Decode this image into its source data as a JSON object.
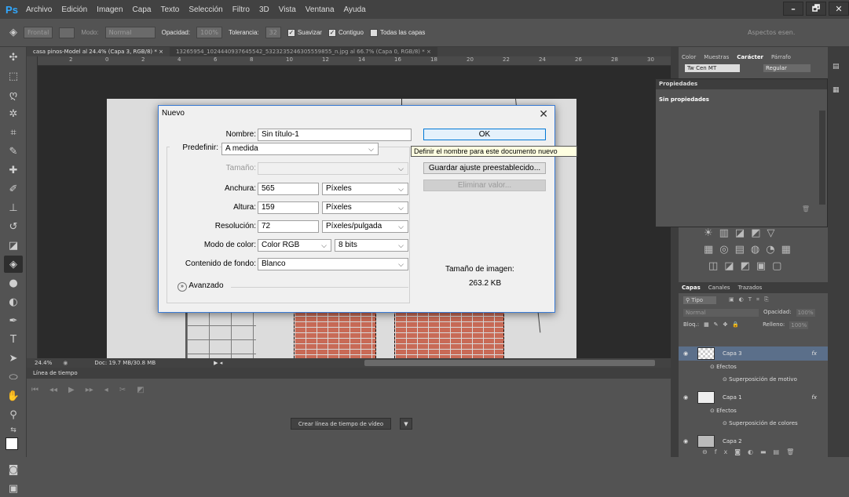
{
  "app": {
    "logo": "Ps"
  },
  "menu": [
    "Archivo",
    "Edición",
    "Imagen",
    "Capa",
    "Texto",
    "Selección",
    "Filtro",
    "3D",
    "Vista",
    "Ventana",
    "Ayuda"
  ],
  "window_controls": {
    "minimize": "–",
    "restore": "🗗",
    "close": "✕"
  },
  "options": {
    "frontal": "Frontal",
    "modo_label": "Modo:",
    "modo_value": "Normal",
    "opacidad_label": "Opacidad:",
    "opacidad_value": "100%",
    "tolerancia_label": "Tolerancia:",
    "tolerancia_value": "32",
    "suavizar": "Suavizar",
    "contiguo": "Contiguo",
    "todas_capas": "Todas las capas",
    "workspace": "Aspectos esen."
  },
  "tabs": [
    "casa pinos-Model al 24.4% (Capa 3, RGB/8) * ×",
    "13265954_1024440937645542_5323235246305559855_n.jpg al 66.7% (Capa 0, RGB/8) * ×"
  ],
  "ruler_ticks": [
    "2",
    "0",
    "2",
    "4",
    "6",
    "8",
    "10",
    "12",
    "14",
    "16",
    "18",
    "20",
    "22",
    "24",
    "26",
    "28",
    "30"
  ],
  "status": {
    "zoom": "24.4%",
    "doc": "Doc: 19.7 MB/30.8 MB"
  },
  "timeline": {
    "title": "Línea de tiempo",
    "create_button": "Crear línea de tiempo de vídeo"
  },
  "character_panel": {
    "tabs": [
      "Color",
      "Muestras",
      "Carácter",
      "Párrafo"
    ],
    "font": "Tw Cen MT",
    "style": "Regular"
  },
  "properties": {
    "title": "Propiedades",
    "empty": "Sin propiedades"
  },
  "layers_panel": {
    "tabs": [
      "Capas",
      "Canales",
      "Trazados"
    ],
    "filter": "Tipo",
    "blend": "Normal",
    "opacity_label": "Opacidad:",
    "opacity_value": "100%",
    "lock_label": "Bloq.:",
    "fill_label": "Relleno:",
    "fill_value": "100%",
    "layers": [
      {
        "name": "Capa 3",
        "fx": "fx",
        "effects": "Efectos",
        "effect": "Superposición de motivo"
      },
      {
        "name": "Capa 1",
        "fx": "fx",
        "effects": "Efectos",
        "effect": "Superposición de colores"
      },
      {
        "name": "Capa 2"
      }
    ]
  },
  "dialog": {
    "title": "Nuevo",
    "nombre_label": "Nombre:",
    "nombre_value": "Sin título-1",
    "predefinir_label": "Predefinir:",
    "predefinir_value": "A medida",
    "tamano_label": "Tamaño:",
    "anchura_label": "Anchura:",
    "anchura_value": "565",
    "anchura_unit": "Píxeles",
    "altura_label": "Altura:",
    "altura_value": "159",
    "altura_unit": "Píxeles",
    "resolucion_label": "Resolución:",
    "resolucion_value": "72",
    "resolucion_unit": "Píxeles/pulgada",
    "modo_label": "Modo de color:",
    "modo_value": "Color RGB",
    "bits_value": "8 bits",
    "fondo_label": "Contenido de fondo:",
    "fondo_value": "Blanco",
    "avanzado": "Avanzado",
    "ok": "OK",
    "guardar": "Guardar ajuste preestablecido...",
    "eliminar": "Eliminar valor...",
    "tamano_imagen_label": "Tamaño de imagen:",
    "tamano_imagen_value": "263.2 KB",
    "tooltip": "Definir el nombre para este documento nuevo"
  }
}
